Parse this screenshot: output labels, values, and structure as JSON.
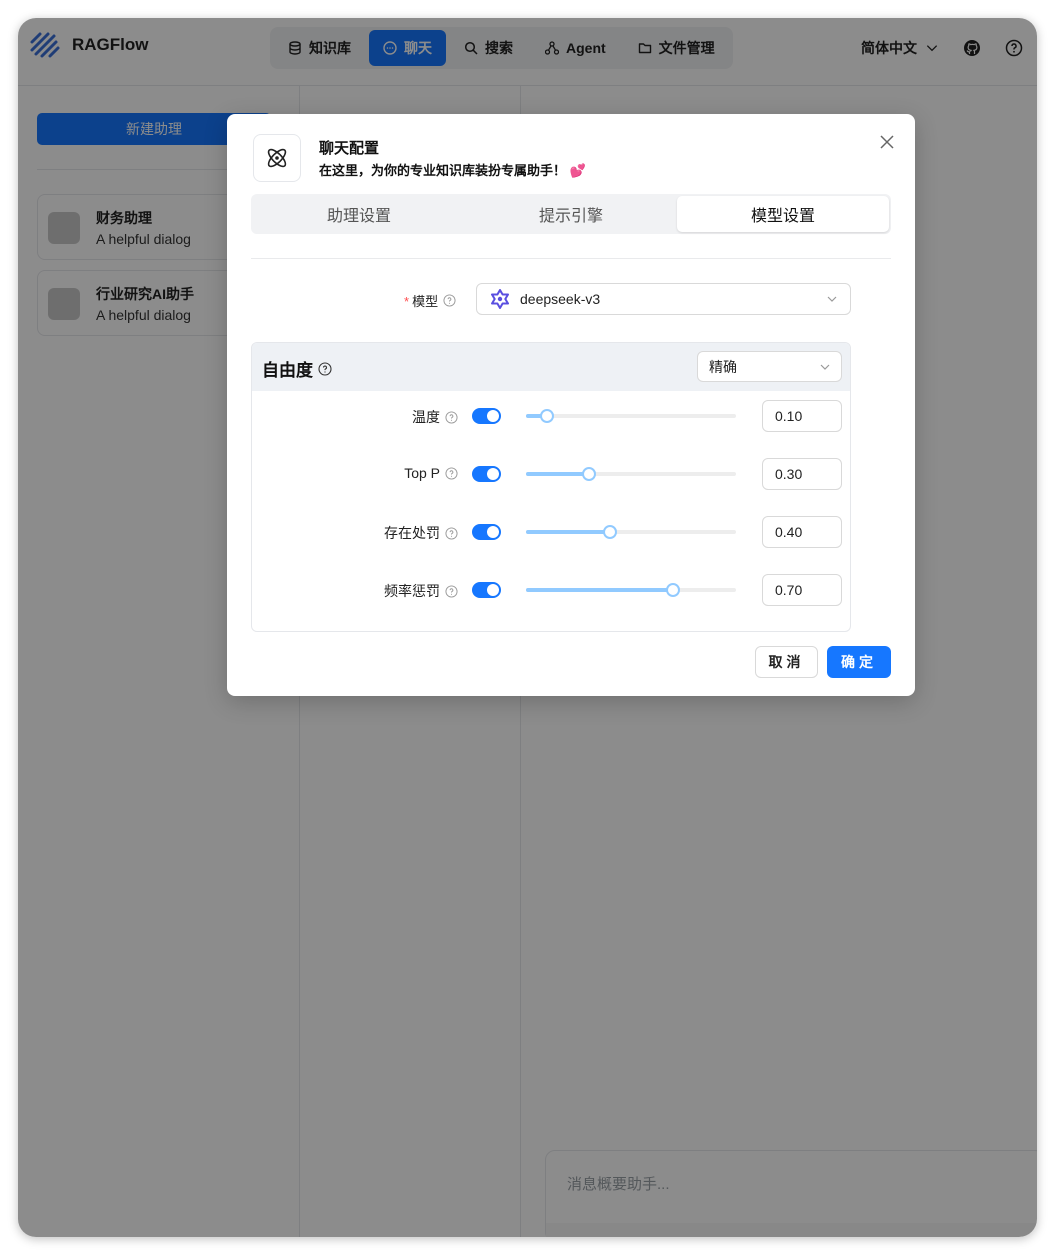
{
  "app": {
    "name": "RAGFlow"
  },
  "nav": [
    {
      "label": "知识库",
      "icon": "database-icon",
      "active": false
    },
    {
      "label": "聊天",
      "icon": "chat-icon",
      "active": true
    },
    {
      "label": "搜索",
      "icon": "search-icon",
      "active": false
    },
    {
      "label": "Agent",
      "icon": "agent-icon",
      "active": false
    },
    {
      "label": "文件管理",
      "icon": "folder-icon",
      "active": false
    }
  ],
  "topright": {
    "language": "简体中文"
  },
  "sidebar": {
    "new_button": "新建助理",
    "assistants": [
      {
        "name": "财务助理",
        "desc": "A helpful dialog"
      },
      {
        "name": "行业研究AI助手",
        "desc": "A helpful dialog"
      }
    ]
  },
  "chat": {
    "input_placeholder": "消息概要助手..."
  },
  "modal": {
    "title": "聊天配置",
    "subtitle": "在这里，为你的专业知识库装扮专属助手！ 💕",
    "tabs": [
      {
        "label": "助理设置",
        "active": false
      },
      {
        "label": "提示引擎",
        "active": false
      },
      {
        "label": "模型设置",
        "active": true
      }
    ],
    "model_label": "模型",
    "model_value": "deepseek-v3",
    "freedom": {
      "title": "自由度",
      "mode": "精确",
      "params": [
        {
          "label": "温度",
          "enabled": true,
          "value": "0.10",
          "fraction": 0.1
        },
        {
          "label": "Top P",
          "enabled": true,
          "value": "0.30",
          "fraction": 0.3
        },
        {
          "label": "存在处罚",
          "enabled": true,
          "value": "0.40",
          "fraction": 0.4
        },
        {
          "label": "频率惩罚",
          "enabled": true,
          "value": "0.70",
          "fraction": 0.7
        }
      ]
    },
    "cancel": "取消",
    "ok": "确定"
  },
  "colors": {
    "primary": "#1677ff",
    "slider": "#91caff"
  }
}
